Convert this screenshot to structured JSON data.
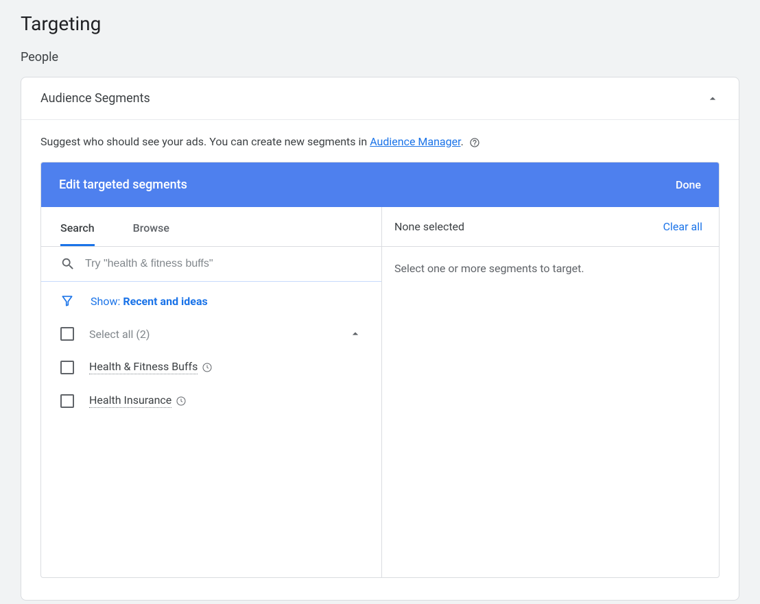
{
  "page": {
    "title": "Targeting",
    "section": "People"
  },
  "card": {
    "title": "Audience Segments",
    "description_prefix": "Suggest who should see your ads.  You can create new segments in ",
    "description_link": "Audience Manager",
    "description_suffix": "."
  },
  "editor": {
    "title": "Edit targeted segments",
    "done_label": "Done",
    "tabs": {
      "search": "Search",
      "browse": "Browse"
    },
    "search_placeholder": "Try \"health & fitness buffs\"",
    "filter": {
      "label": "Show: ",
      "value": "Recent and ideas"
    },
    "select_all_label": "Select all (2)",
    "items": [
      {
        "label": "Health & Fitness Buffs"
      },
      {
        "label": "Health Insurance"
      }
    ],
    "right": {
      "none_label": "None selected",
      "clear_label": "Clear all",
      "hint": "Select one or more segments to target."
    }
  }
}
